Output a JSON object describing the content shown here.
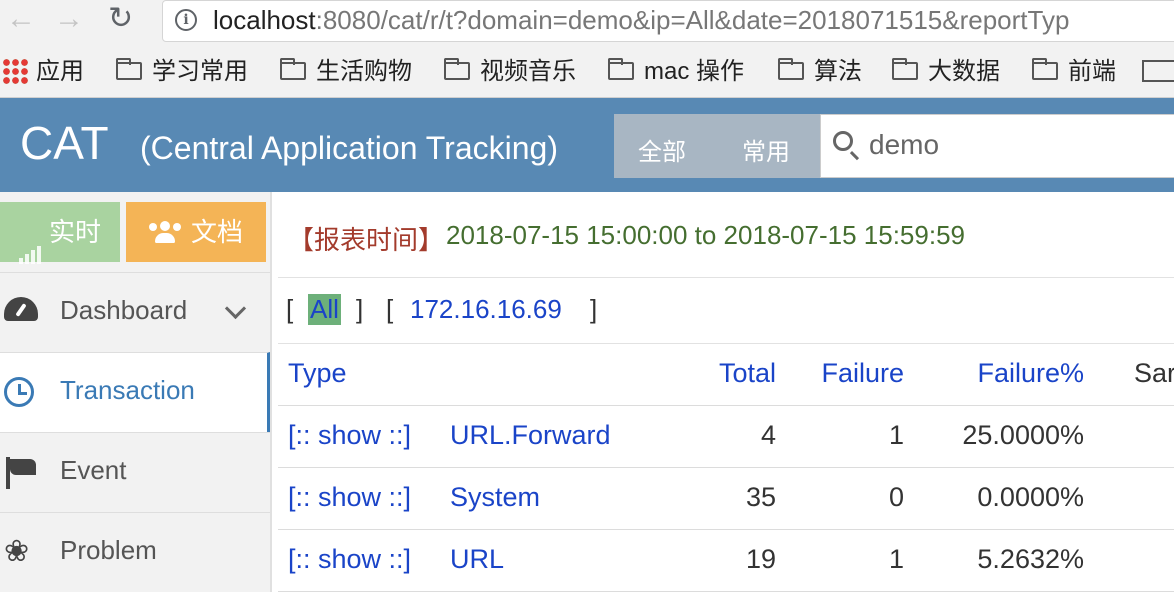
{
  "browser": {
    "url_prefix": "localhost",
    "url_rest": ":8080/cat/r/t?domain=demo&ip=All&date=2018071515&reportTyp",
    "bookmarks": [
      {
        "label": "应用",
        "icon": "apps-grid-icon"
      },
      {
        "label": "学习常用",
        "icon": "folder-icon"
      },
      {
        "label": "生活购物",
        "icon": "folder-icon"
      },
      {
        "label": "视频音乐",
        "icon": "folder-icon"
      },
      {
        "label": "mac 操作",
        "icon": "folder-icon"
      },
      {
        "label": "算法",
        "icon": "folder-icon"
      },
      {
        "label": "大数据",
        "icon": "folder-icon"
      },
      {
        "label": "前端",
        "icon": "folder-icon"
      }
    ]
  },
  "header": {
    "logo": "CAT",
    "subtitle": "(Central Application Tracking)",
    "tabs": [
      "全部",
      "常用"
    ],
    "search_value": "demo"
  },
  "sidebar": {
    "realtime_label": "实时",
    "docs_label": "文档",
    "items": [
      {
        "label": "Dashboard",
        "icon": "dashboard-gauge-icon"
      },
      {
        "label": "Transaction",
        "icon": "clock-icon"
      },
      {
        "label": "Event",
        "icon": "flag-icon"
      },
      {
        "label": "Problem",
        "icon": "bug-icon"
      }
    ]
  },
  "report": {
    "time_label": "【报表时间】",
    "time_range": "2018-07-15 15:00:00 to 2018-07-15 15:59:59",
    "ip_all": "All",
    "ip_address": "172.16.16.69",
    "bracket_open": "[",
    "bracket_close": "]"
  },
  "table": {
    "columns": [
      "Type",
      "Total",
      "Failure",
      "Failure%",
      "Sar"
    ],
    "rows": [
      {
        "show": "[:: show ::]",
        "type": "URL.Forward",
        "total": "4",
        "failure": "1",
        "failure_pct": "25.0000%"
      },
      {
        "show": "[:: show ::]",
        "type": "System",
        "total": "35",
        "failure": "0",
        "failure_pct": "0.0000%"
      },
      {
        "show": "[:: show ::]",
        "type": "URL",
        "total": "19",
        "failure": "1",
        "failure_pct": "5.2632%"
      }
    ]
  },
  "colors": {
    "header_bg": "#5889b4",
    "realtime_btn": "#a9d3a0",
    "docs_btn": "#f4b456",
    "link_blue": "#1a44c8",
    "time_label_red": "#a33b2c",
    "time_value_green": "#456e30"
  }
}
